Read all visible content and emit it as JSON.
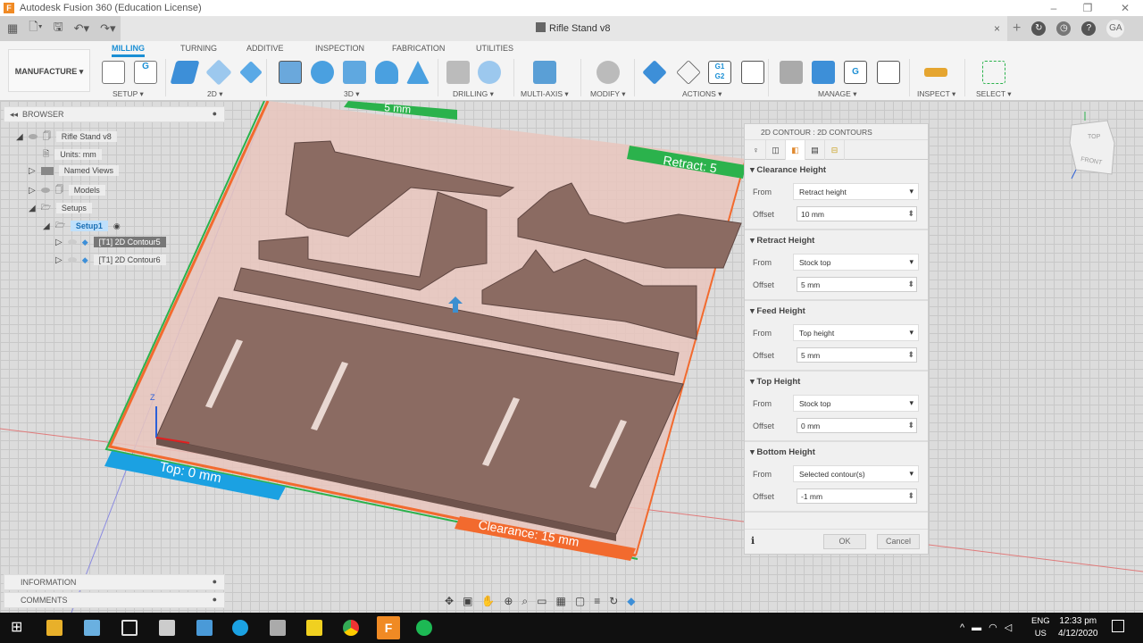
{
  "window": {
    "title": "Autodesk Fusion 360 (Education License)",
    "doc_tab": "Rifle Stand v8",
    "user_initials": "GA"
  },
  "ribbon": {
    "workspace": "MANUFACTURE ▾",
    "tabs": [
      "MILLING",
      "TURNING",
      "ADDITIVE",
      "INSPECTION",
      "FABRICATION",
      "UTILITIES"
    ],
    "groups": [
      "SETUP ▾",
      "2D ▾",
      "3D ▾",
      "DRILLING ▾",
      "MULTI-AXIS ▾",
      "MODIFY ▾",
      "ACTIONS ▾",
      "MANAGE ▾",
      "INSPECT ▾",
      "SELECT ▾"
    ],
    "icon_glyphs": {
      "gcode": "G",
      "g1g2": "G1\nG2"
    }
  },
  "browser": {
    "header": "BROWSER",
    "items": [
      "Rifle Stand v8",
      "Units: mm",
      "Named Views",
      "Models",
      "Setups",
      "Setup1",
      "[T1] 2D Contour5",
      "[T1] 2D Contour6"
    ]
  },
  "viewport": {
    "labels": {
      "top": "Top: 0 mm",
      "clearance": "Clearance: 15 mm",
      "retract": "Retract: 5",
      "partial": "5 mm"
    },
    "viewcube": {
      "top": "TOP",
      "front": "FRONT"
    },
    "colors": {
      "stock": "#e9c6bd",
      "part": "#8b6b62",
      "clearance": "#f26a2e",
      "retract": "#2bb24c",
      "top": "#1ba1e2"
    }
  },
  "dialog": {
    "title": "2D CONTOUR : 2D CONTOURS",
    "sections": [
      {
        "title": "Clearance Height",
        "from": "Retract height",
        "offset": "10 mm"
      },
      {
        "title": "Retract Height",
        "from": "Stock top",
        "offset": "5 mm"
      },
      {
        "title": "Feed Height",
        "from": "Top height",
        "offset": "5 mm"
      },
      {
        "title": "Top Height",
        "from": "Stock top",
        "offset": "0 mm"
      },
      {
        "title": "Bottom Height",
        "from": "Selected contour(s)",
        "offset": "-1 mm"
      }
    ],
    "from_label": "From",
    "offset_label": "Offset",
    "ok": "OK",
    "cancel": "Cancel"
  },
  "bottom_panels": {
    "information": "INFORMATION",
    "comments": "COMMENTS"
  },
  "taskbar": {
    "lang1": "ENG",
    "lang2": "US",
    "time": "12:33 pm",
    "date": "4/12/2020"
  }
}
